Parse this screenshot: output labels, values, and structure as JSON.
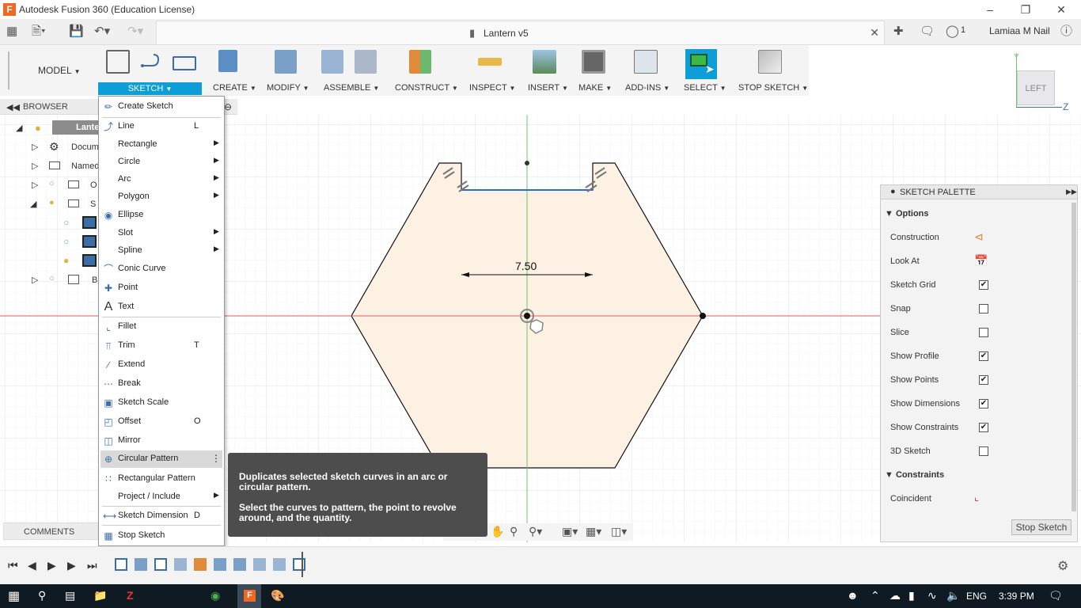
{
  "app": {
    "window_title": "Autodesk Fusion 360 (Education License)",
    "doc_title": "Lantern v5",
    "user": "Lamiaa M Nail",
    "notifications": "1"
  },
  "toolbar": {
    "workspace": "MODEL",
    "sketch": "SKETCH",
    "create": "CREATE",
    "modify": "MODIFY",
    "assemble": "ASSEMBLE",
    "construct": "CONSTRUCT",
    "inspect": "INSPECT",
    "insert": "INSERT",
    "make": "MAKE",
    "addins": "ADD-INS",
    "select": "SELECT",
    "stop_sketch": "STOP SKETCH"
  },
  "browser": {
    "header": "BROWSER",
    "rows": [
      "Lante",
      "Docum",
      "Named",
      "O",
      "S",
      "B"
    ]
  },
  "menu": [
    {
      "label": "Create Sketch",
      "key": "",
      "arrow": false
    },
    {
      "label": "Line",
      "key": "L",
      "arrow": false
    },
    {
      "label": "Rectangle",
      "key": "",
      "arrow": true
    },
    {
      "label": "Circle",
      "key": "",
      "arrow": true
    },
    {
      "label": "Arc",
      "key": "",
      "arrow": true
    },
    {
      "label": "Polygon",
      "key": "",
      "arrow": true
    },
    {
      "label": "Ellipse",
      "key": "",
      "arrow": false
    },
    {
      "label": "Slot",
      "key": "",
      "arrow": true
    },
    {
      "label": "Spline",
      "key": "",
      "arrow": true
    },
    {
      "label": "Conic Curve",
      "key": "",
      "arrow": false
    },
    {
      "label": "Point",
      "key": "",
      "arrow": false
    },
    {
      "label": "Text",
      "key": "",
      "arrow": false
    },
    {
      "label": "Fillet",
      "key": "",
      "arrow": false
    },
    {
      "label": "Trim",
      "key": "T",
      "arrow": false
    },
    {
      "label": "Extend",
      "key": "",
      "arrow": false
    },
    {
      "label": "Break",
      "key": "",
      "arrow": false
    },
    {
      "label": "Sketch Scale",
      "key": "",
      "arrow": false
    },
    {
      "label": "Offset",
      "key": "O",
      "arrow": false
    },
    {
      "label": "Mirror",
      "key": "",
      "arrow": false
    },
    {
      "label": "Circular Pattern",
      "key": "",
      "arrow": false
    },
    {
      "label": "Rectangular Pattern",
      "key": "",
      "arrow": false
    },
    {
      "label": "Project / Include",
      "key": "",
      "arrow": true
    },
    {
      "label": "Sketch Dimension",
      "key": "D",
      "arrow": false
    },
    {
      "label": "Stop Sketch",
      "key": "",
      "arrow": false
    }
  ],
  "tooltip": {
    "line1": "Duplicates selected sketch curves in an arc or circular pattern.",
    "line2": "Select the curves to pattern, the point to revolve around, and the quantity."
  },
  "dimension": "7.50",
  "viewcube": {
    "face": "LEFT",
    "z": "Z",
    "y": "Y"
  },
  "comments": "COMMENTS",
  "palette": {
    "title": "SKETCH PALETTE",
    "options_header": "Options",
    "options": [
      {
        "label": "Construction",
        "kind": "icon"
      },
      {
        "label": "Look At",
        "kind": "icon"
      },
      {
        "label": "Sketch Grid",
        "kind": "check",
        "checked": true
      },
      {
        "label": "Snap",
        "kind": "check",
        "checked": false
      },
      {
        "label": "Slice",
        "kind": "check",
        "checked": false
      },
      {
        "label": "Show Profile",
        "kind": "check",
        "checked": true
      },
      {
        "label": "Show Points",
        "kind": "check",
        "checked": true
      },
      {
        "label": "Show Dimensions",
        "kind": "check",
        "checked": true
      },
      {
        "label": "Show Constraints",
        "kind": "check",
        "checked": true
      },
      {
        "label": "3D Sketch",
        "kind": "check",
        "checked": false
      }
    ],
    "constraints_header": "Constraints",
    "constraints": [
      "Coincident"
    ],
    "stop_button": "Stop Sketch"
  },
  "taskbar": {
    "lang": "ENG",
    "time": "3:39 PM"
  },
  "colors": {
    "accent": "#0d9ed8",
    "profile_fill": "#fdf1e3",
    "axis_red": "#e05a5a",
    "axis_green": "#6cc46c"
  }
}
